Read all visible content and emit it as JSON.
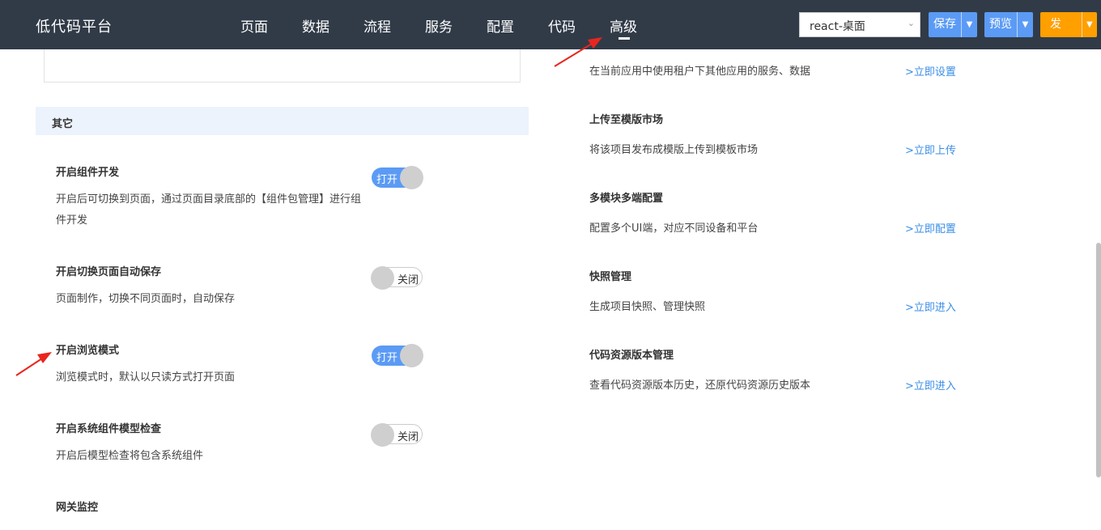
{
  "header": {
    "brand": "低代码平台",
    "nav": [
      "页面",
      "数据",
      "流程",
      "服务",
      "配置",
      "代码",
      "高级"
    ],
    "active_nav": "高级",
    "app_select": "react-桌面",
    "buttons": {
      "save": "保存",
      "preview": "预览",
      "publish": "发布"
    }
  },
  "left": {
    "section_title": "其它",
    "settings": [
      {
        "title": "开启组件开发",
        "desc": "开启后可切换到页面，通过页面目录底部的【组件包管理】进行组件开发",
        "state": "打开",
        "on": true
      },
      {
        "title": "开启切换页面自动保存",
        "desc": "页面制作，切换不同页面时，自动保存",
        "state": "关闭",
        "on": false
      },
      {
        "title": "开启浏览模式",
        "desc": "浏览模式时，默认以只读方式打开页面",
        "state": "打开",
        "on": true
      },
      {
        "title": "开启系统组件模型检查",
        "desc": "开启后模型检查将包含系统组件",
        "state": "关闭",
        "on": false
      },
      {
        "title": "网关监控",
        "desc": "",
        "state": "",
        "on": false
      }
    ]
  },
  "right": {
    "top_desc": "在当前应用中使用租户下其他应用的服务、数据",
    "top_link": ">立即设置",
    "items": [
      {
        "title": "上传至模版市场",
        "desc": "将该项目发布成模版上传到模板市场",
        "link": ">立即上传"
      },
      {
        "title": "多模块多端配置",
        "desc": "配置多个UI端，对应不同设备和平台",
        "link": ">立即配置"
      },
      {
        "title": "快照管理",
        "desc": "生成项目快照、管理快照",
        "link": ">立即进入"
      },
      {
        "title": "代码资源版本管理",
        "desc": "查看代码资源版本历史，还原代码资源历史版本",
        "link": ">立即进入"
      }
    ]
  },
  "colors": {
    "topbar": "#313b48",
    "accent_blue": "#5b9bf5",
    "publish_orange": "#ff9f00",
    "link_blue": "#3a8ee6",
    "section_bg": "#edf3fc",
    "annotation_red": "#e8261f"
  },
  "icons": [
    "dropdown-chevron-icon",
    "caret-down-icon",
    "annotation-arrow-icon"
  ]
}
